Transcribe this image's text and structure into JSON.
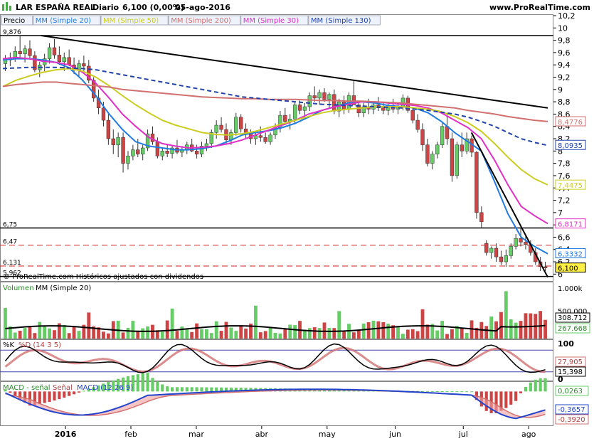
{
  "header": {
    "title": "LAR ESPAÑA REAL",
    "period": "Diario",
    "price": "6,100 (0,00%)",
    "date": "05-ago-2016",
    "site": "www.ProRealTime.com"
  },
  "copyright": "© ProRealTime.com  Históricos ajustados con dividendos",
  "colors": {
    "up": "#66cc66",
    "down": "#cc4444",
    "sma20": "#1e7be0",
    "sma50": "#cccc22",
    "sma200": "#d27070",
    "sma30": "#e030c8",
    "sma130": "#2244aa",
    "trend": "#000000",
    "level_dash": "#cc2222"
  },
  "chart_data": [
    {
      "name": "price",
      "type": "candlestick",
      "legend": [
        "Precio",
        "MM (Simple 20)",
        "MM (Simple 50)",
        "MM (Simple 200)",
        "MM (Simple 30)",
        "MM (Simple 130)"
      ],
      "ylim": [
        5.9,
        10.2
      ],
      "yticks": [
        10.2,
        10,
        9.8,
        9.6,
        9.4,
        9.2,
        9,
        8.8,
        8.6,
        8.4,
        8.2,
        8,
        7.8,
        7.6,
        7.4,
        7.2,
        7,
        6.8,
        6.6,
        6.4,
        6.2,
        6
      ],
      "ytick_labels": [
        "10,2",
        "10",
        "9,8",
        "9,6",
        "9,4",
        "9,2",
        "9",
        "8,8",
        "8,6",
        "8,4",
        "8,2",
        "8",
        "7,8",
        "7,6",
        "7,4",
        "7,2",
        "7",
        "6,8",
        "6,6",
        "6,4",
        "6,2",
        "6"
      ],
      "xlabels": [
        "2016",
        "feb",
        "mar",
        "abr",
        "may",
        "jun",
        "jul",
        "ago"
      ],
      "ma_labels": [
        {
          "name": "MM (Simple 200)",
          "value": 8.4776,
          "text": "8,4776"
        },
        {
          "name": "MM (Simple 130)",
          "value": 8.0935,
          "text": "8,0935"
        },
        {
          "name": "MM (Simple 50)",
          "value": 7.4475,
          "text": "7,4475"
        },
        {
          "name": "MM (Simple 30)",
          "value": 6.8171,
          "text": "6,8171"
        },
        {
          "name": "MM (Simple 20)",
          "value": 6.3332,
          "text": "6,3332"
        },
        {
          "name": "Precio",
          "value": 6.1,
          "text": "6,100"
        }
      ],
      "levels": [
        {
          "value": 9.876,
          "text": "9,876",
          "style": "solid"
        },
        {
          "value": 6.75,
          "text": "6,75",
          "style": "solid"
        },
        {
          "value": 6.47,
          "text": "6,47",
          "style": "dashed"
        },
        {
          "value": 6.131,
          "text": "6,131",
          "style": "dashed"
        },
        {
          "value": 5.962,
          "text": "5,962",
          "style": "solid"
        }
      ],
      "ohlc": [
        [
          9.42,
          9.56,
          9.3,
          9.48
        ],
        [
          9.48,
          9.6,
          9.38,
          9.52
        ],
        [
          9.52,
          9.7,
          9.45,
          9.62
        ],
        [
          9.62,
          9.88,
          9.5,
          9.58
        ],
        [
          9.58,
          9.72,
          9.44,
          9.66
        ],
        [
          9.66,
          9.8,
          9.5,
          9.55
        ],
        [
          9.55,
          9.62,
          9.28,
          9.32
        ],
        [
          9.32,
          9.45,
          9.2,
          9.4
        ],
        [
          9.4,
          9.58,
          9.3,
          9.5
        ],
        [
          9.5,
          9.75,
          9.42,
          9.68
        ],
        [
          9.68,
          9.82,
          9.5,
          9.56
        ],
        [
          9.56,
          9.7,
          9.4,
          9.45
        ],
        [
          9.45,
          9.6,
          9.3,
          9.52
        ],
        [
          9.52,
          9.65,
          9.38,
          9.4
        ],
        [
          9.4,
          9.52,
          9.25,
          9.32
        ],
        [
          9.32,
          9.48,
          9.2,
          9.42
        ],
        [
          9.42,
          9.55,
          9.3,
          9.38
        ],
        [
          9.38,
          9.48,
          9.1,
          9.15
        ],
        [
          9.15,
          9.2,
          8.8,
          8.86
        ],
        [
          8.86,
          9.0,
          8.6,
          8.7
        ],
        [
          8.7,
          8.8,
          8.4,
          8.5
        ],
        [
          8.5,
          8.62,
          8.1,
          8.2
        ],
        [
          8.2,
          8.35,
          7.95,
          8.1
        ],
        [
          8.1,
          8.3,
          7.9,
          8.22
        ],
        [
          8.22,
          8.3,
          7.65,
          7.8
        ],
        [
          7.8,
          8.0,
          7.7,
          7.92
        ],
        [
          7.92,
          8.1,
          7.85,
          8.02
        ],
        [
          8.02,
          8.2,
          7.9,
          7.95
        ],
        [
          7.95,
          8.1,
          7.85,
          8.05
        ],
        [
          8.05,
          8.35,
          8.0,
          8.28
        ],
        [
          8.28,
          8.4,
          8.1,
          8.15
        ],
        [
          8.15,
          8.22,
          7.88,
          7.92
        ],
        [
          7.92,
          8.05,
          7.85,
          8.0
        ],
        [
          8.0,
          8.12,
          7.9,
          7.96
        ],
        [
          7.96,
          8.1,
          7.88,
          8.05
        ],
        [
          8.05,
          8.18,
          7.95,
          7.98
        ],
        [
          7.98,
          8.08,
          7.9,
          8.02
        ],
        [
          8.02,
          8.15,
          7.95,
          8.1
        ],
        [
          8.1,
          8.2,
          7.98,
          8.0
        ],
        [
          8.0,
          8.1,
          7.88,
          7.95
        ],
        [
          7.95,
          8.15,
          7.9,
          8.08
        ],
        [
          8.08,
          8.2,
          8.0,
          8.12
        ],
        [
          8.12,
          8.35,
          8.05,
          8.3
        ],
        [
          8.3,
          8.5,
          8.2,
          8.42
        ],
        [
          8.42,
          8.55,
          8.3,
          8.35
        ],
        [
          8.35,
          8.45,
          8.1,
          8.18
        ],
        [
          8.18,
          8.35,
          8.1,
          8.3
        ],
        [
          8.3,
          8.62,
          8.25,
          8.55
        ],
        [
          8.55,
          8.6,
          8.3,
          8.36
        ],
        [
          8.36,
          8.45,
          8.2,
          8.28
        ],
        [
          8.28,
          8.35,
          8.12,
          8.2
        ],
        [
          8.2,
          8.32,
          8.1,
          8.25
        ],
        [
          8.25,
          8.4,
          8.15,
          8.22
        ],
        [
          8.22,
          8.3,
          8.12,
          8.15
        ],
        [
          8.15,
          8.3,
          8.1,
          8.26
        ],
        [
          8.26,
          8.45,
          8.2,
          8.38
        ],
        [
          8.38,
          8.65,
          8.3,
          8.58
        ],
        [
          8.58,
          8.7,
          8.42,
          8.48
        ],
        [
          8.48,
          8.6,
          8.35,
          8.52
        ],
        [
          8.52,
          8.8,
          8.45,
          8.75
        ],
        [
          8.75,
          8.82,
          8.6,
          8.66
        ],
        [
          8.66,
          8.78,
          8.55,
          8.72
        ],
        [
          8.72,
          8.95,
          8.65,
          8.9
        ],
        [
          8.9,
          9.05,
          8.8,
          8.86
        ],
        [
          8.86,
          9.0,
          8.75,
          8.95
        ],
        [
          8.95,
          9.02,
          8.8,
          8.84
        ],
        [
          8.84,
          8.95,
          8.7,
          8.92
        ],
        [
          8.92,
          9.0,
          8.6,
          8.65
        ],
        [
          8.65,
          8.85,
          8.55,
          8.8
        ],
        [
          8.8,
          8.9,
          8.6,
          8.68
        ],
        [
          8.68,
          8.95,
          8.62,
          8.9
        ],
        [
          8.9,
          9.15,
          8.82,
          8.75
        ],
        [
          8.75,
          8.82,
          8.55,
          8.62
        ],
        [
          8.62,
          8.78,
          8.55,
          8.72
        ],
        [
          8.72,
          8.85,
          8.6,
          8.68
        ],
        [
          8.68,
          8.8,
          8.6,
          8.75
        ],
        [
          8.75,
          8.88,
          8.65,
          8.7
        ],
        [
          8.7,
          8.8,
          8.6,
          8.66
        ],
        [
          8.66,
          8.78,
          8.58,
          8.74
        ],
        [
          8.74,
          8.85,
          8.62,
          8.68
        ],
        [
          8.68,
          8.78,
          8.6,
          8.72
        ],
        [
          8.72,
          8.92,
          8.66,
          8.86
        ],
        [
          8.86,
          8.9,
          8.62,
          8.66
        ],
        [
          8.66,
          8.72,
          8.45,
          8.5
        ],
        [
          8.5,
          8.6,
          8.3,
          8.35
        ],
        [
          8.35,
          8.45,
          8.0,
          8.1
        ],
        [
          8.1,
          8.2,
          7.75,
          7.8
        ],
        [
          7.8,
          8.0,
          7.7,
          7.95
        ],
        [
          7.95,
          8.15,
          7.88,
          8.1
        ],
        [
          8.1,
          8.45,
          8.05,
          8.4
        ],
        [
          8.4,
          8.6,
          8.1,
          8.2
        ],
        [
          8.2,
          8.3,
          7.5,
          7.6
        ],
        [
          7.6,
          8.15,
          7.55,
          8.1
        ],
        [
          8.1,
          8.3,
          7.9,
          8.0
        ],
        [
          8.0,
          8.3,
          7.95,
          8.2
        ],
        [
          8.2,
          8.25,
          7.9,
          7.98
        ],
        [
          7.98,
          8.0,
          6.9,
          7.0
        ],
        [
          7.0,
          7.1,
          6.75,
          6.85
        ],
        [
          6.5,
          6.55,
          6.3,
          6.35
        ],
        [
          6.35,
          6.45,
          6.25,
          6.42
        ],
        [
          6.42,
          6.5,
          6.2,
          6.28
        ],
        [
          6.28,
          6.38,
          6.15,
          6.2
        ],
        [
          6.2,
          6.4,
          6.12,
          6.3
        ],
        [
          6.3,
          6.5,
          6.25,
          6.45
        ],
        [
          6.45,
          6.65,
          6.4,
          6.58
        ],
        [
          6.58,
          6.75,
          6.45,
          6.52
        ],
        [
          6.52,
          6.62,
          6.4,
          6.48
        ],
        [
          6.48,
          6.55,
          6.3,
          6.35
        ],
        [
          6.35,
          6.42,
          6.15,
          6.2
        ],
        [
          6.2,
          6.28,
          6.05,
          6.12
        ],
        [
          6.12,
          6.2,
          6.05,
          6.1
        ]
      ],
      "ma": {
        "MM (Simple 20)": [
          9.48,
          9.5,
          9.5,
          9.48,
          9.44,
          9.35,
          9.15,
          8.9,
          8.6,
          8.35,
          8.15,
          8.08,
          8.05,
          8.02,
          8.02,
          8.04,
          8.08,
          8.16,
          8.26,
          8.3,
          8.33,
          8.38,
          8.45,
          8.55,
          8.66,
          8.72,
          8.78,
          8.8,
          8.78,
          8.74,
          8.72,
          8.7,
          8.62,
          8.48,
          8.3,
          8.15,
          8.0,
          7.5,
          6.98,
          6.6,
          6.45,
          6.33
        ],
        "MM (Simple 30)": [
          9.5,
          9.52,
          9.5,
          9.46,
          9.44,
          9.4,
          9.28,
          9.1,
          8.86,
          8.6,
          8.4,
          8.22,
          8.12,
          8.08,
          8.05,
          8.06,
          8.08,
          8.12,
          8.18,
          8.26,
          8.34,
          8.42,
          8.5,
          8.6,
          8.66,
          8.72,
          8.76,
          8.8,
          8.8,
          8.78,
          8.76,
          8.74,
          8.7,
          8.62,
          8.5,
          8.38,
          8.2,
          7.85,
          7.45,
          7.1,
          6.95,
          6.82
        ],
        "MM (Simple 50)": [
          9.05,
          9.15,
          9.22,
          9.28,
          9.32,
          9.34,
          9.3,
          9.2,
          9.06,
          8.9,
          8.75,
          8.62,
          8.5,
          8.42,
          8.36,
          8.3,
          8.27,
          8.26,
          8.28,
          8.32,
          8.38,
          8.44,
          8.5,
          8.56,
          8.62,
          8.66,
          8.68,
          8.7,
          8.72,
          8.72,
          8.72,
          8.7,
          8.68,
          8.64,
          8.56,
          8.46,
          8.32,
          8.12,
          7.9,
          7.7,
          7.55,
          7.45
        ],
        "MM (Simple 200)": [
          9.05,
          9.08,
          9.1,
          9.12,
          9.12,
          9.1,
          9.08,
          9.06,
          9.04,
          9.0,
          8.98,
          8.96,
          8.94,
          8.92,
          8.9,
          8.88,
          8.87,
          8.86,
          8.85,
          8.85,
          8.84,
          8.84,
          8.84,
          8.83,
          8.82,
          8.82,
          8.81,
          8.81,
          8.8,
          8.79,
          8.78,
          8.76,
          8.74,
          8.72,
          8.7,
          8.66,
          8.63,
          8.6,
          8.56,
          8.53,
          8.5,
          8.48
        ],
        "MM (Simple 130)": [
          9.34,
          9.35,
          9.36,
          9.36,
          9.36,
          9.35,
          9.34,
          9.32,
          9.28,
          9.24,
          9.2,
          9.16,
          9.12,
          9.08,
          9.04,
          9.0,
          8.96,
          8.92,
          8.88,
          8.86,
          8.84,
          8.82,
          8.8,
          8.78,
          8.76,
          8.75,
          8.74,
          8.73,
          8.72,
          8.71,
          8.7,
          8.68,
          8.66,
          8.63,
          8.6,
          8.55,
          8.48,
          8.4,
          8.3,
          8.2,
          8.14,
          8.09
        ]
      },
      "trendlines": [
        {
          "from": [
            0.07,
            9.876
          ],
          "to": [
            1.0,
            8.7
          ]
        },
        {
          "from": [
            0.86,
            8.3
          ],
          "to": [
            1.0,
            5.95
          ]
        }
      ]
    },
    {
      "name": "volume",
      "type": "bar",
      "legend": [
        "Volumen",
        "MM (Simple 20)"
      ],
      "ylim": [
        0,
        1000000
      ],
      "ytick_labels": [
        "1.000k",
        "500.000"
      ],
      "ma_label": "308.712",
      "last_label": "267.668"
    },
    {
      "name": "stochastic",
      "type": "line",
      "legend": [
        "%K",
        "%D (14 3 5)"
      ],
      "ylim": [
        0,
        100
      ],
      "ytick_labels": [
        "100",
        "0"
      ],
      "values_labels": [
        "27,905",
        "15,398"
      ],
      "levels": [
        20,
        80
      ]
    },
    {
      "name": "macd",
      "type": "line",
      "legend": [
        "MACD - señal",
        "Señal",
        "MACD (12 26 9)"
      ],
      "ylim": [
        -0.45,
        0.1
      ],
      "values_labels": [
        "0,0263",
        "-0,3657",
        "-0,3920"
      ]
    }
  ]
}
